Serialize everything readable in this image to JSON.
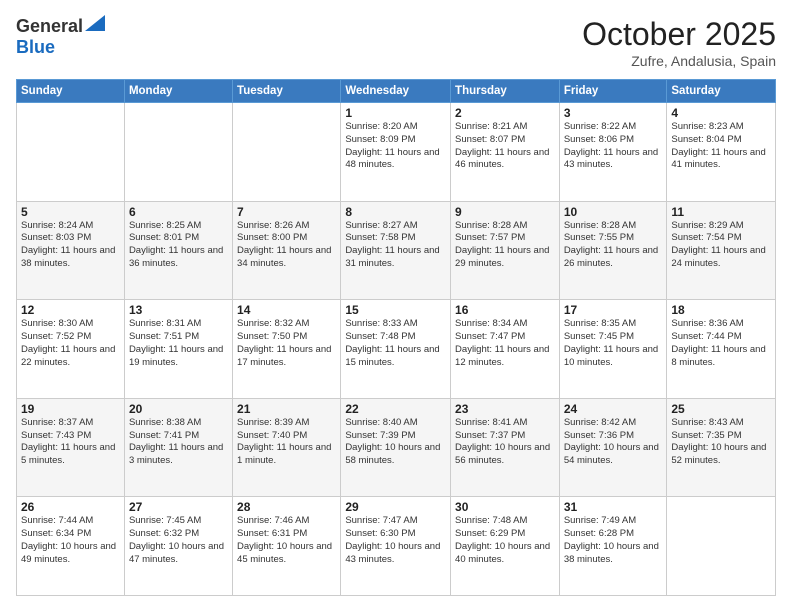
{
  "header": {
    "logo_line1": "General",
    "logo_line2": "Blue",
    "month": "October 2025",
    "location": "Zufre, Andalusia, Spain"
  },
  "weekdays": [
    "Sunday",
    "Monday",
    "Tuesday",
    "Wednesday",
    "Thursday",
    "Friday",
    "Saturday"
  ],
  "weeks": [
    [
      {
        "day": "",
        "info": ""
      },
      {
        "day": "",
        "info": ""
      },
      {
        "day": "",
        "info": ""
      },
      {
        "day": "1",
        "info": "Sunrise: 8:20 AM\nSunset: 8:09 PM\nDaylight: 11 hours and 48 minutes."
      },
      {
        "day": "2",
        "info": "Sunrise: 8:21 AM\nSunset: 8:07 PM\nDaylight: 11 hours and 46 minutes."
      },
      {
        "day": "3",
        "info": "Sunrise: 8:22 AM\nSunset: 8:06 PM\nDaylight: 11 hours and 43 minutes."
      },
      {
        "day": "4",
        "info": "Sunrise: 8:23 AM\nSunset: 8:04 PM\nDaylight: 11 hours and 41 minutes."
      }
    ],
    [
      {
        "day": "5",
        "info": "Sunrise: 8:24 AM\nSunset: 8:03 PM\nDaylight: 11 hours and 38 minutes."
      },
      {
        "day": "6",
        "info": "Sunrise: 8:25 AM\nSunset: 8:01 PM\nDaylight: 11 hours and 36 minutes."
      },
      {
        "day": "7",
        "info": "Sunrise: 8:26 AM\nSunset: 8:00 PM\nDaylight: 11 hours and 34 minutes."
      },
      {
        "day": "8",
        "info": "Sunrise: 8:27 AM\nSunset: 7:58 PM\nDaylight: 11 hours and 31 minutes."
      },
      {
        "day": "9",
        "info": "Sunrise: 8:28 AM\nSunset: 7:57 PM\nDaylight: 11 hours and 29 minutes."
      },
      {
        "day": "10",
        "info": "Sunrise: 8:28 AM\nSunset: 7:55 PM\nDaylight: 11 hours and 26 minutes."
      },
      {
        "day": "11",
        "info": "Sunrise: 8:29 AM\nSunset: 7:54 PM\nDaylight: 11 hours and 24 minutes."
      }
    ],
    [
      {
        "day": "12",
        "info": "Sunrise: 8:30 AM\nSunset: 7:52 PM\nDaylight: 11 hours and 22 minutes."
      },
      {
        "day": "13",
        "info": "Sunrise: 8:31 AM\nSunset: 7:51 PM\nDaylight: 11 hours and 19 minutes."
      },
      {
        "day": "14",
        "info": "Sunrise: 8:32 AM\nSunset: 7:50 PM\nDaylight: 11 hours and 17 minutes."
      },
      {
        "day": "15",
        "info": "Sunrise: 8:33 AM\nSunset: 7:48 PM\nDaylight: 11 hours and 15 minutes."
      },
      {
        "day": "16",
        "info": "Sunrise: 8:34 AM\nSunset: 7:47 PM\nDaylight: 11 hours and 12 minutes."
      },
      {
        "day": "17",
        "info": "Sunrise: 8:35 AM\nSunset: 7:45 PM\nDaylight: 11 hours and 10 minutes."
      },
      {
        "day": "18",
        "info": "Sunrise: 8:36 AM\nSunset: 7:44 PM\nDaylight: 11 hours and 8 minutes."
      }
    ],
    [
      {
        "day": "19",
        "info": "Sunrise: 8:37 AM\nSunset: 7:43 PM\nDaylight: 11 hours and 5 minutes."
      },
      {
        "day": "20",
        "info": "Sunrise: 8:38 AM\nSunset: 7:41 PM\nDaylight: 11 hours and 3 minutes."
      },
      {
        "day": "21",
        "info": "Sunrise: 8:39 AM\nSunset: 7:40 PM\nDaylight: 11 hours and 1 minute."
      },
      {
        "day": "22",
        "info": "Sunrise: 8:40 AM\nSunset: 7:39 PM\nDaylight: 10 hours and 58 minutes."
      },
      {
        "day": "23",
        "info": "Sunrise: 8:41 AM\nSunset: 7:37 PM\nDaylight: 10 hours and 56 minutes."
      },
      {
        "day": "24",
        "info": "Sunrise: 8:42 AM\nSunset: 7:36 PM\nDaylight: 10 hours and 54 minutes."
      },
      {
        "day": "25",
        "info": "Sunrise: 8:43 AM\nSunset: 7:35 PM\nDaylight: 10 hours and 52 minutes."
      }
    ],
    [
      {
        "day": "26",
        "info": "Sunrise: 7:44 AM\nSunset: 6:34 PM\nDaylight: 10 hours and 49 minutes."
      },
      {
        "day": "27",
        "info": "Sunrise: 7:45 AM\nSunset: 6:32 PM\nDaylight: 10 hours and 47 minutes."
      },
      {
        "day": "28",
        "info": "Sunrise: 7:46 AM\nSunset: 6:31 PM\nDaylight: 10 hours and 45 minutes."
      },
      {
        "day": "29",
        "info": "Sunrise: 7:47 AM\nSunset: 6:30 PM\nDaylight: 10 hours and 43 minutes."
      },
      {
        "day": "30",
        "info": "Sunrise: 7:48 AM\nSunset: 6:29 PM\nDaylight: 10 hours and 40 minutes."
      },
      {
        "day": "31",
        "info": "Sunrise: 7:49 AM\nSunset: 6:28 PM\nDaylight: 10 hours and 38 minutes."
      },
      {
        "day": "",
        "info": ""
      }
    ]
  ]
}
